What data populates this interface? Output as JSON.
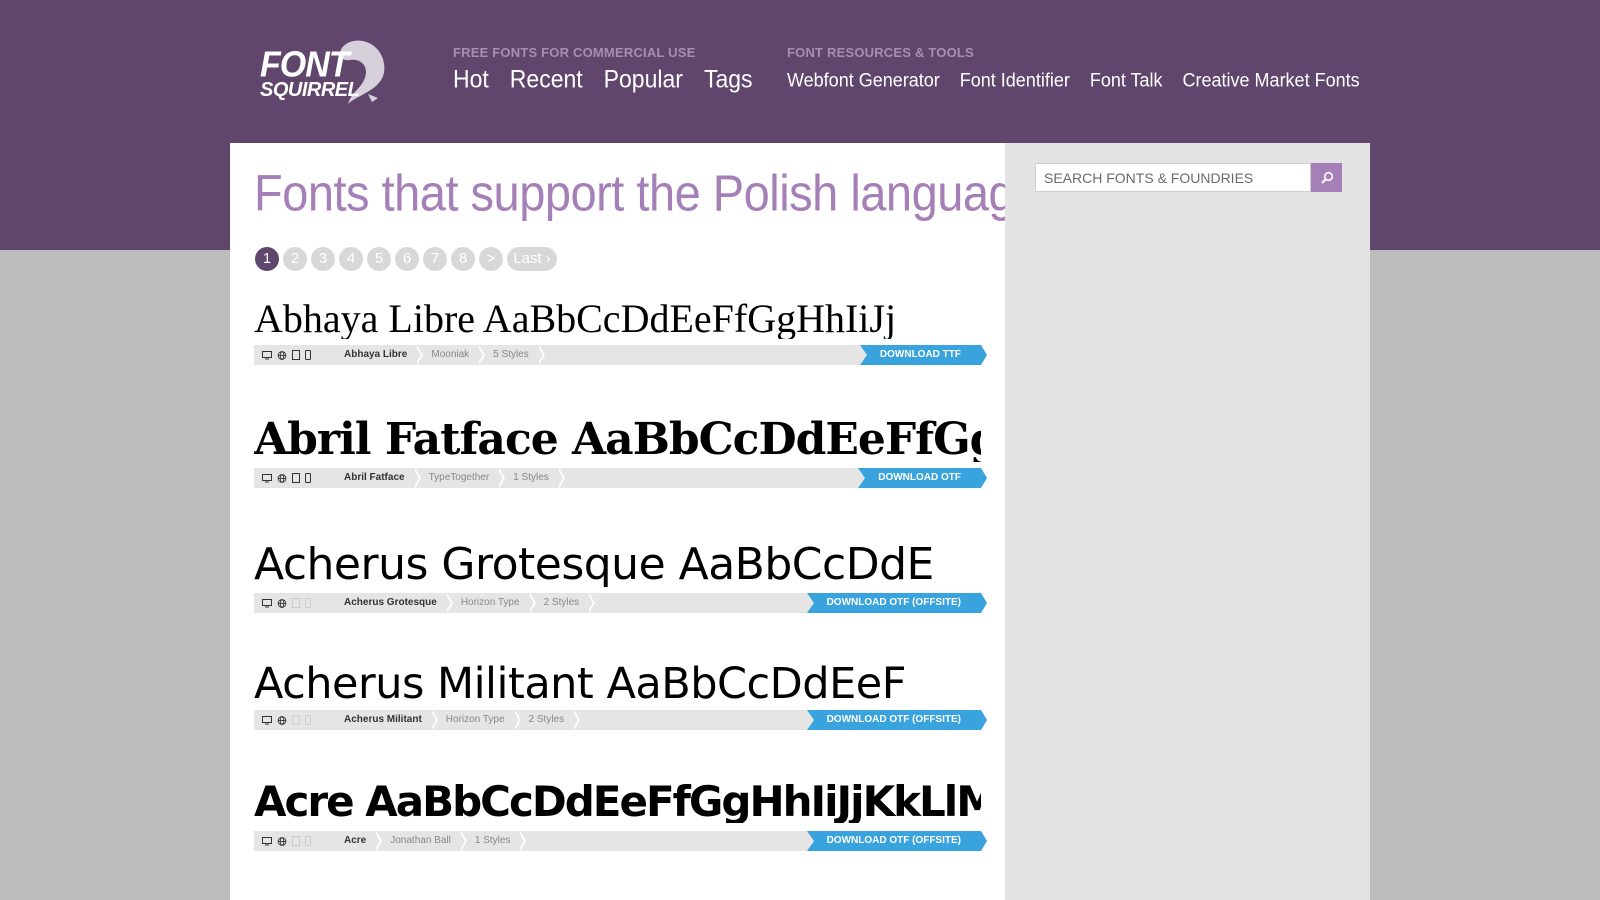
{
  "brand": {
    "logo_line1": "FONT",
    "logo_line2": "SQUIRREL"
  },
  "nav": {
    "free_heading": "FREE FONTS FOR COMMERCIAL USE",
    "free_links": [
      "Hot",
      "Recent",
      "Popular",
      "Tags"
    ],
    "resources_heading": "FONT RESOURCES & TOOLS",
    "resources_links": [
      "Webfont Generator",
      "Font Identifier",
      "Font Talk",
      "Creative Market Fonts"
    ]
  },
  "page": {
    "title": "Fonts that support the Polish language"
  },
  "pagination": {
    "pages": [
      "1",
      "2",
      "3",
      "4",
      "5",
      "6",
      "7",
      "8"
    ],
    "next": ">",
    "last": "Last ›",
    "current": "1"
  },
  "search": {
    "placeholder": "SEARCH FONTS & FOUNDRIES"
  },
  "fonts": [
    {
      "sample": "Abhaya Libre AaBbCcDdEeFfGgHhIiJj",
      "name": "Abhaya Libre",
      "foundry": "Mooniak",
      "styles": "5 Styles",
      "download": "DOWNLOAD TTF"
    },
    {
      "sample": "Abril Fatface AaBbCcDdEeFfGgH",
      "name": "Abril Fatface",
      "foundry": "TypeTogether",
      "styles": "1 Styles",
      "download": "DOWNLOAD OTF"
    },
    {
      "sample": "Acherus Grotesque AaBbCcDdE",
      "name": "Acherus Grotesque",
      "foundry": "Horizon Type",
      "styles": "2 Styles",
      "download": "DOWNLOAD OTF (OFFSITE)"
    },
    {
      "sample": "Acherus Militant AaBbCcDdEeF",
      "name": "Acherus Militant",
      "foundry": "Horizon Type",
      "styles": "2 Styles",
      "download": "DOWNLOAD OTF (OFFSITE)"
    },
    {
      "sample": "Acre AaBbCcDdEeFfGgHhIiJjKkLlM",
      "name": "Acre",
      "foundry": "Jonathan Ball",
      "styles": "1 Styles",
      "download": "DOWNLOAD OTF (OFFSITE)"
    }
  ],
  "icons": {
    "desktop": "desktop-icon",
    "web": "globe-icon",
    "tablet": "tablet-icon",
    "mobile": "phone-icon",
    "search": "magnifier-icon"
  },
  "colors": {
    "header_bg": "#60466c",
    "title": "#a57fb8",
    "download": "#38a3dc",
    "sidebar": "#e3e3e3",
    "page_bg": "#bdbdbd"
  }
}
